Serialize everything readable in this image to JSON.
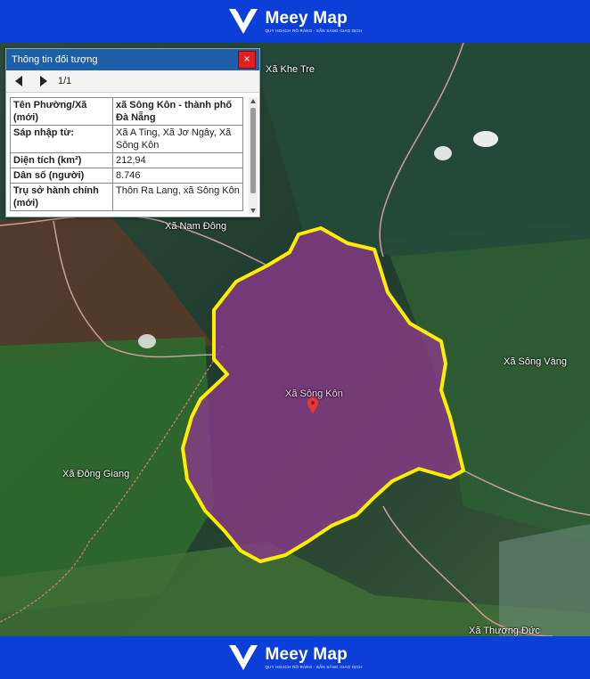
{
  "brand": {
    "name": "Meey Map",
    "tagline": "QUY HOẠCH RÕ RÀNG - SẴN SÀNG GIAO DỊCH"
  },
  "panel": {
    "title": "Thông tin đối tượng",
    "close_label": "×",
    "pager": "1/1",
    "rows": [
      {
        "key": "Tên Phường/Xã (mới)",
        "value": "xã Sông Kôn - thành phố Đà Nẵng"
      },
      {
        "key": "Sáp nhập từ:",
        "value": "Xã A Ting, Xã Jơ Ngây, Xã Sông Kôn"
      },
      {
        "key": "Diện tích (km²)",
        "value": "212,94"
      },
      {
        "key": "Dân số (người)",
        "value": "8.746"
      },
      {
        "key": "Trụ sở hành chính (mới)",
        "value": "Thôn Ra Lang, xã Sông Kôn"
      }
    ]
  },
  "map": {
    "places": {
      "khe_tre": "Xã Khe Tre",
      "nam_dong": "Xã Nam Đông",
      "song_vang": "Xã Sông Vàng",
      "dong_giang": "Xã Đông Giang",
      "thuong_duc": "Xã Thượng Đức",
      "song_kon": "Xã Sông Kôn"
    },
    "colors": {
      "highlight_fill": "#8a3a8a",
      "highlight_border": "#ffee00",
      "pin": "#e53935",
      "banner": "#0b3fd8"
    }
  }
}
